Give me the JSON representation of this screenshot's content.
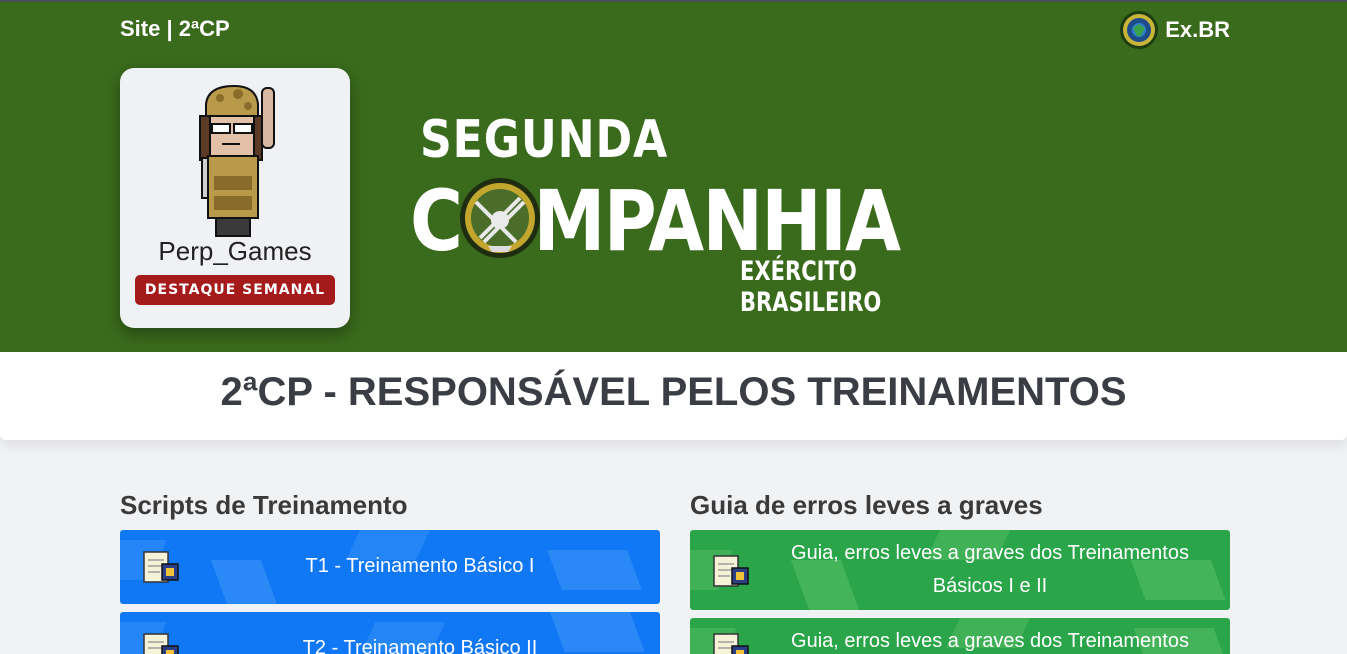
{
  "header": {
    "site_link": "Site | 2ªCP",
    "brand_label": "Ex.BR",
    "brand_icon": "exbr-emblem-icon"
  },
  "profile": {
    "name": "Perp_Games",
    "badge": "DESTAQUE SEMANAL"
  },
  "logo": {
    "line1": "SEGUNDA",
    "line2_prefix": "C",
    "line2_suffix": "MPANHIA",
    "line3": "EXÉRCITO BRASILEIRO"
  },
  "page_title": "2ªCP - RESPONSÁVEL PELOS TREINAMENTOS",
  "sections": {
    "scripts": {
      "title": "Scripts de Treinamento",
      "items": [
        {
          "label": "T1 - Treinamento Básico I"
        },
        {
          "label": "T2 - Treinamento Básico II"
        }
      ]
    },
    "guides": {
      "title": "Guia de erros leves a graves",
      "items": [
        {
          "line1": "Guia, erros leves a graves dos Treinamentos",
          "line2": "Básicos I e II"
        },
        {
          "line1": "Guia, erros leves a graves dos Treinamentos"
        }
      ]
    }
  },
  "colors": {
    "hero_green": "#3a6b1c",
    "badge_red": "#a51b1b",
    "card_blue": "#1078f4",
    "card_green": "#2aa54a"
  }
}
